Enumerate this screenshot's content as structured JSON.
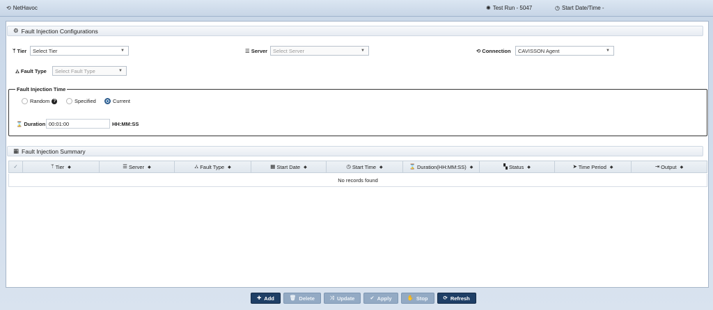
{
  "header": {
    "app_title": "NetHavoc",
    "test_run": "Test Run - 5047",
    "start_datetime": "Start Date/Time -"
  },
  "config": {
    "title": "Fault Injection Configurations",
    "tier_label": "Tier",
    "tier_placeholder": "Select Tier",
    "server_label": "Server",
    "server_placeholder": "Select Server",
    "connection_label": "Connection",
    "connection_value": "CAVISSON Agent",
    "fault_type_label": "Fault Type",
    "fault_type_placeholder": "Select Fault Type"
  },
  "injection_time": {
    "legend": "Fault Injection Time",
    "options": [
      "Random",
      "Specified",
      "Current"
    ],
    "selected": "Current",
    "duration_label": "Duration",
    "duration_value": "00:01:00",
    "duration_format": "HH:MM:SS"
  },
  "summary": {
    "title": "Fault Injection Summary",
    "columns": [
      "Tier",
      "Server",
      "Fault Type",
      "Start Date",
      "Start Time",
      "Duration(HH:MM:SS)",
      "Status",
      "Time Period",
      "Output"
    ],
    "empty_message": "No records found"
  },
  "buttons": {
    "add": "Add",
    "delete": "Delete",
    "update": "Update",
    "apply": "Apply",
    "stop": "Stop",
    "refresh": "Refresh"
  }
}
